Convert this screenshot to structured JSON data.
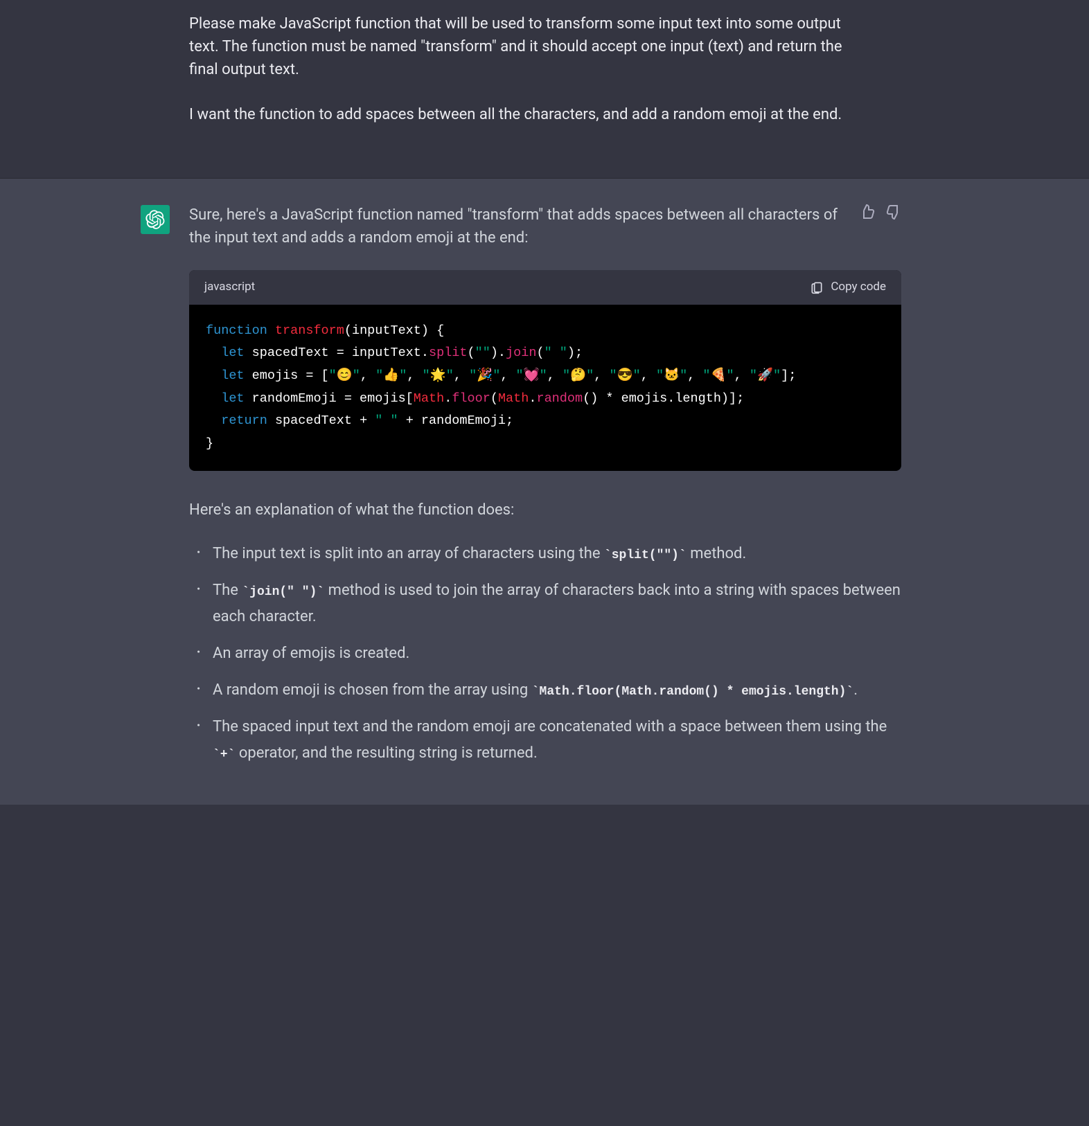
{
  "user": {
    "p1": "Please make JavaScript function that will be used to transform some input text into some output text. The function must be named \"transform\" and it should accept one input (text) and return the final output text.",
    "p2": "I want the function to add spaces between all the characters, and add a random emoji at the end."
  },
  "assistant": {
    "intro": "Sure, here's a JavaScript function named \"transform\" that adds spaces between all characters of the input text and adds a random emoji at the end:",
    "code_lang": "javascript",
    "copy_label": "Copy code",
    "code": {
      "l1_kw": "function",
      "l1_name": "transform",
      "l1_rest": "(inputText) {",
      "l2_kw": "let",
      "l2_a": " spacedText = inputText.",
      "l2_split": "split",
      "l2_b": "(",
      "l2_s1": "\"\"",
      "l2_c": ").",
      "l2_join": "join",
      "l2_d": "(",
      "l2_s2": "\" \"",
      "l2_e": ");",
      "l3_kw": "let",
      "l3_a": " emojis = [",
      "l3_e1": "\"😊\"",
      "l3_e2": "\"👍\"",
      "l3_e3": "\"🌟\"",
      "l3_e4": "\"🎉\"",
      "l3_e5": "\"💓\"",
      "l3_e6": "\"🤔\"",
      "l3_e7": "\"😎\"",
      "l3_e8": "\"🐱\"",
      "l3_e9": "\"🍕\"",
      "l3_e10": "\"🚀\"",
      "l3_sep": ", ",
      "l3_end": "];",
      "l4_kw": "let",
      "l4_a": " randomEmoji = emojis[",
      "l4_math1": "Math",
      "l4_b": ".",
      "l4_floor": "floor",
      "l4_c": "(",
      "l4_math2": "Math",
      "l4_d": ".",
      "l4_random": "random",
      "l4_e": "() * emojis.length)];",
      "l5_kw": "return",
      "l5_a": " spacedText + ",
      "l5_s": "\" \"",
      "l5_b": " + randomEmoji;",
      "l6": "}"
    },
    "explain_intro": "Here's an explanation of what the function does:",
    "bullets": {
      "b1_a": "The input text is split into an array of characters using the ",
      "b1_code": "`split(\"\")`",
      "b1_b": " method.",
      "b2_a": "The ",
      "b2_code": "`join(\" \")`",
      "b2_b": " method is used to join the array of characters back into a string with spaces between each character.",
      "b3": "An array of emojis is created.",
      "b4_a": "A random emoji is chosen from the array using ",
      "b4_code": "`Math.floor(Math.random() * emojis.length)`",
      "b4_b": ".",
      "b5_a": "The spaced input text and the random emoji are concatenated with a space between them using the ",
      "b5_code": "`+`",
      "b5_b": " operator, and the resulting string is returned."
    }
  }
}
